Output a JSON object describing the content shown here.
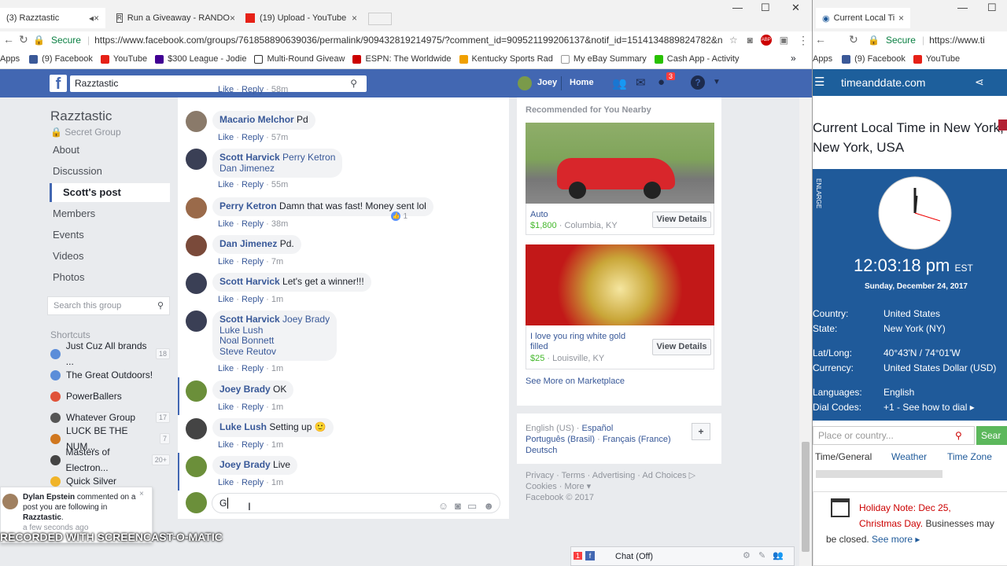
{
  "left_window": {
    "tabs": [
      {
        "title": "(3) Razztastic",
        "close": "×",
        "extra": "◂×"
      },
      {
        "title": "Run a Giveaway - RANDO",
        "close": "×"
      },
      {
        "title": "(19) Upload - YouTube",
        "close": "×"
      }
    ],
    "window_controls": {
      "min": "—",
      "max": "☐",
      "close": "✕"
    },
    "address": {
      "secure": "Secure",
      "url": "https://www.facebook.com/groups/761858890639036/permalink/909432819214975/?comment_id=909521199206137&notif_id=1514134889824782&no..."
    },
    "bookmarks": [
      "Apps",
      "(9) Facebook",
      "YouTube",
      "$300 League - Jodie",
      "Multi-Round Giveaw",
      "ESPN: The Worldwide",
      "Kentucky Sports Rad",
      "My eBay Summary",
      "Cash App - Activity"
    ],
    "bookmarks_more": "»"
  },
  "fb": {
    "search_value": "Razztastic",
    "user": "Joey",
    "home": "Home",
    "notif_count": "3"
  },
  "group": {
    "title": "Razztastic",
    "subtitle": "Secret Group",
    "nav": [
      "About",
      "Discussion",
      "Scott's post",
      "Members",
      "Events",
      "Videos",
      "Photos"
    ],
    "search_placeholder": "Search this group",
    "shortcuts_label": "Shortcuts",
    "shortcuts": [
      {
        "name": "Just Cuz All brands ...",
        "count": "18",
        "color": "#5b8dd9"
      },
      {
        "name": "The Great Outdoors!",
        "count": "",
        "color": "#5b8dd9"
      },
      {
        "name": "PowerBallers",
        "count": "",
        "color": "#e0533a"
      },
      {
        "name": "Whatever Group",
        "count": "17",
        "color": "#555555"
      },
      {
        "name": "LUCK BE THE NUM...",
        "count": "7",
        "color": "#d0771f"
      },
      {
        "name": "Masters of Electron...",
        "count": "20+",
        "color": "#444444"
      },
      {
        "name": "Quick Silver",
        "count": "",
        "color": "#f0b429"
      }
    ]
  },
  "comments": [
    {
      "name": "",
      "text": "",
      "time": "58m",
      "top_partial": true
    },
    {
      "name": "Macario Melchor",
      "text": "Pd",
      "time": "57m"
    },
    {
      "name": "Scott Harvick",
      "tags": [
        "Perry Ketron",
        "Dan Jimenez"
      ],
      "time": "55m"
    },
    {
      "name": "Perry Ketron",
      "text": "Damn that was fast! Money sent lol",
      "time": "38m",
      "reaction": "1"
    },
    {
      "name": "Dan Jimenez",
      "text": "Pd.",
      "time": "7m"
    },
    {
      "name": "Scott Harvick",
      "text": "Let's get a winner!!!",
      "time": "1m"
    },
    {
      "name": "Scott Harvick",
      "tags": [
        "Joey Brady",
        "Luke Lush",
        "Noal Bonnett",
        "Steve Reutov"
      ],
      "time": "1m"
    },
    {
      "name": "Joey Brady",
      "text": "OK",
      "time": "1m"
    },
    {
      "name": "Luke Lush",
      "text": "Setting up 🙂",
      "time": "1m"
    },
    {
      "name": "Joey Brady",
      "text": "Live",
      "time": "1m"
    }
  ],
  "comment_actions": {
    "like": "Like",
    "reply": "Reply",
    "sep": "·"
  },
  "compose": {
    "value": "G"
  },
  "marketplace": {
    "header": "Recommended for You Nearby",
    "items": [
      {
        "title": "Auto",
        "price": "$1,800",
        "location": "Columbia, KY",
        "button": "View Details"
      },
      {
        "title": "I love you ring white gold filled",
        "price": "$25",
        "location": "Louisville, KY",
        "button": "View Details"
      }
    ],
    "see_more": "See More on Marketplace"
  },
  "languages": {
    "current": "English (US)",
    "others": [
      "Español",
      "Português (Brasil)",
      "Français (France)",
      "Deutsch"
    ],
    "plus": "+"
  },
  "footer": {
    "links": [
      "Privacy",
      "Terms",
      "Advertising",
      "Ad Choices",
      "Cookies",
      "More"
    ],
    "copyright": "Facebook © 2017"
  },
  "chat": {
    "label": "Chat (Off)",
    "badge": "1"
  },
  "notification": {
    "actor": "Dylan Epstein",
    "text": " commented on a post you are following in ",
    "group": "Razztastic",
    "time": "a few seconds ago"
  },
  "watermark": "RECORDED WITH SCREENCAST-O-MATIC",
  "right_window": {
    "tab": "Current Local Ti",
    "secure": "Secure",
    "url": "https://www.ti",
    "bookmarks": [
      "Apps",
      "(9) Facebook",
      "YouTube"
    ],
    "site": "timeanddate.com",
    "heading": "Current Local Time in New York, New York, USA",
    "enlarge": "ENLARGE",
    "time": "12:03:18 pm",
    "tz": "EST",
    "date": "Sunday, December 24, 2017",
    "info": [
      {
        "label": "Country:",
        "value": "United States"
      },
      {
        "label": "State:",
        "value": "New York (NY)"
      },
      {
        "label": "Lat/Long:",
        "value": "40°43'N / 74°01'W"
      },
      {
        "label": "Currency:",
        "value": "United States Dollar (USD)"
      },
      {
        "label": "Languages:",
        "value": "English"
      },
      {
        "label": "Dial Codes:",
        "value": "+1 - See how to dial ▸"
      }
    ],
    "search_placeholder": "Place or country...",
    "search_button": "Sear",
    "tabs": [
      "Time/General",
      "Weather",
      "Time Zone"
    ],
    "holiday_label": "Holiday Note:",
    "holiday_date": "Dec 25,",
    "holiday_name": "Christmas Day.",
    "holiday_text": " Businesses may be closed.",
    "see_more": "See more ▸"
  },
  "colors": {
    "fb_blue": "#4267b2",
    "link": "#385898",
    "td_blue": "#1f5a9a",
    "green": "#42b72a"
  }
}
